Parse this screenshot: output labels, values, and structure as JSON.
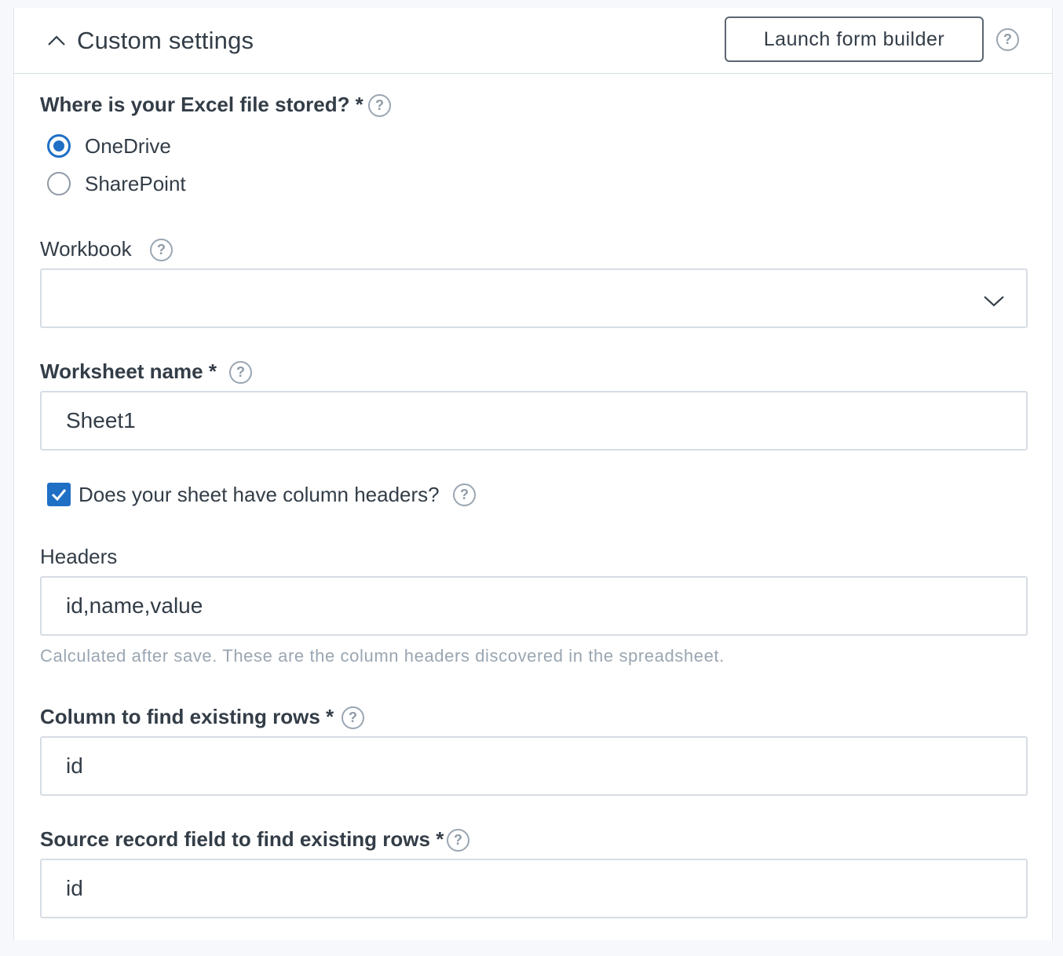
{
  "header": {
    "title": "Custom settings",
    "launch_button": "Launch form builder",
    "help": "?"
  },
  "storage": {
    "label": "Where is your Excel file stored? *",
    "help": "?",
    "options": [
      {
        "label": "OneDrive",
        "checked": true
      },
      {
        "label": "SharePoint",
        "checked": false
      }
    ]
  },
  "workbook": {
    "label": "Workbook",
    "help": "?",
    "value": ""
  },
  "worksheet": {
    "label": "Worksheet name *",
    "help": "?",
    "value": "Sheet1"
  },
  "column_headers_checkbox": {
    "label": "Does your sheet have column headers?",
    "checked": true,
    "help": "?"
  },
  "headers": {
    "label": "Headers",
    "value": "id,name,value",
    "hint": "Calculated after save. These are the column headers discovered in the spreadsheet."
  },
  "find_column": {
    "label": "Column to find existing rows *",
    "help": "?",
    "value": "id"
  },
  "source_field": {
    "label": "Source record field to find existing rows *",
    "help": "?",
    "value": "id"
  },
  "colors": {
    "accent": "#1f6fc5",
    "text": "#333d47",
    "muted": "#9aa6b2",
    "border": "#d7dde4"
  },
  "icons": {
    "collapse": "chevron-up-icon",
    "dropdown": "chevron-down-icon",
    "help": "question-circle-icon",
    "check": "checkmark-icon"
  }
}
